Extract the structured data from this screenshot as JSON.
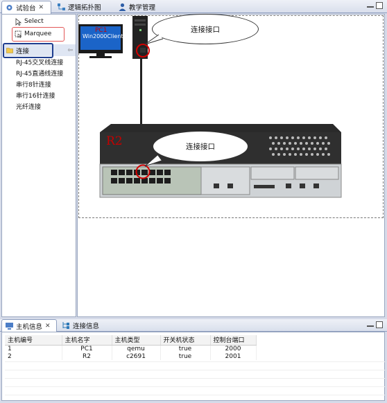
{
  "top_tabs": [
    {
      "label": "试验台",
      "close": "✕"
    },
    {
      "label": "逻辑拓扑图"
    },
    {
      "label": "教学管理"
    }
  ],
  "palette": {
    "select_label": "Select",
    "marquee_label": "Marquee",
    "group_label": "连接",
    "connections": [
      "RJ-45交叉线连接",
      "RJ-45直通线连接",
      "串行8针连接",
      "串行16针连接",
      "光纤连接"
    ]
  },
  "canvas": {
    "pc": {
      "name": "PC1",
      "os_label": "Win2000Client"
    },
    "router": {
      "name": "R2"
    },
    "bubble_top": "连接接口",
    "bubble_router": "连接接口",
    "accent_color": "#d40000"
  },
  "bottom_tabs": [
    {
      "label": "主机信息",
      "close": "✕"
    },
    {
      "label": "连接信息"
    }
  ],
  "host_table": {
    "columns": [
      "主机编号",
      "主机名字",
      "主机类型",
      "开关机状态",
      "控制台端口"
    ],
    "rows": [
      [
        "1",
        "PC1",
        "qemu",
        "true",
        "2000"
      ],
      [
        "2",
        "R2",
        "c2691",
        "true",
        "2001"
      ]
    ]
  }
}
